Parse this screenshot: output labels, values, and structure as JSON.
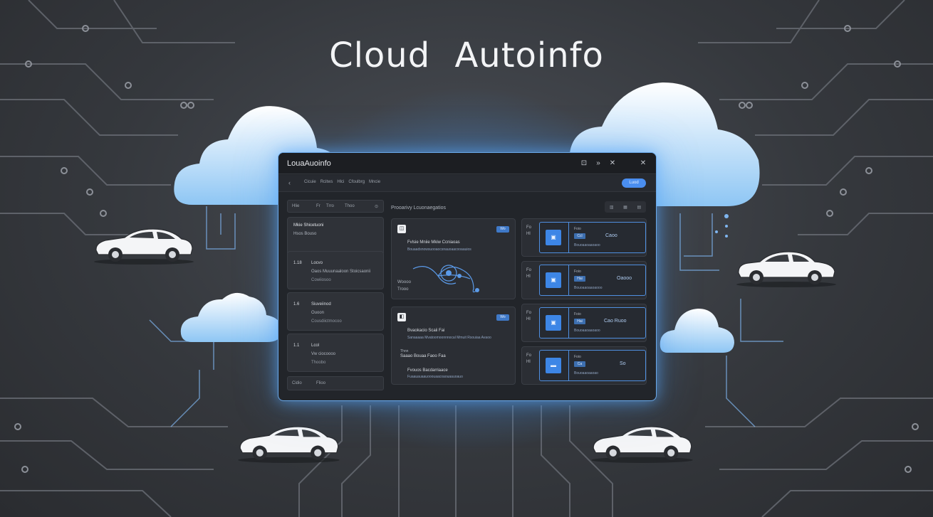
{
  "hero": {
    "title": "Cloud Autoinfo"
  },
  "window": {
    "title": "LouaAuoinfo",
    "controls": {
      "min": "⊡",
      "max": "»",
      "restore": "✕",
      "close": "✕"
    }
  },
  "toolbar": {
    "back": "‹",
    "nav": [
      "Cicuie",
      "Rcitws",
      "Hlci",
      "Cfoulbrg",
      "Mncie"
    ],
    "action": "Luod"
  },
  "sidebar": {
    "filter": [
      "Hlie",
      "Fr",
      "Trro",
      "Thoo",
      "⊙"
    ],
    "vehicles": [
      {
        "id": "",
        "line1": "Mkie Shicetuoni",
        "line2": "Hsos Bouso",
        "line3": ""
      },
      {
        "id": "1.18",
        "line1": "Locvo",
        "line2": "Oaos Muuunaaloon Stoicsaonii",
        "line3": "Cowiiosoo"
      },
      {
        "id": "1.6",
        "line1": "Siuveiinod",
        "line2": "Ouoon",
        "line3": "Cousdiictmocoo"
      },
      {
        "id": "1.1",
        "line1": "Lcol",
        "line2": "Vw ciocoooo",
        "line3": "Thoobo"
      }
    ],
    "footer": [
      "Cidio",
      "Flioo"
    ]
  },
  "main": {
    "section_title": "Prooarivy Lcuonaegatios",
    "view_buttons": [
      "▥",
      "▦",
      "▤"
    ],
    "cards": [
      {
        "icon": "◫",
        "tag": "Wo",
        "heading": "Fvlsie Mniie Mkiw Ccniaoas",
        "subheading": "Bouaadsnowsuooaocsnauoaacooaauios",
        "meta1": "Woooo",
        "meta2": "Trooo"
      },
      {
        "icon": "◧",
        "tag": "Wo",
        "line1": "Bvaokacio Scaii Fai",
        "line2": "Sanaaaaa Mvatoomoonnnocal Mmuit Rsouiaa Avaoo",
        "line3": "Thnn",
        "line4": "Saaao Bouaa Faoo Faa",
        "line5": "Fvouos Bacdarriaace",
        "line6": "Fuaauauaauooouaacoaouaauoauo"
      }
    ],
    "stats": [
      {
        "side1": "Fo",
        "side2": "Hl",
        "label": "Foio",
        "chip": "Ccl",
        "value": "Caoo",
        "sub": "Bouoaaoaaoaoo"
      },
      {
        "side1": "Fo",
        "side2": "Hl",
        "label": "Foio",
        "chip": "Hai",
        "value": "Oaooo",
        "sub": "Bouoaaoaaoaooo"
      },
      {
        "side1": "Fo",
        "side2": "Hl",
        "label": "Foio",
        "chip": "Hai",
        "value": "Cao Ruoo",
        "sub": "Bouoaaoaaoaoo"
      },
      {
        "side1": "Fo",
        "side2": "Hl",
        "label": "Foio",
        "chip": "Ca",
        "value": "So",
        "sub": "Bouoaaoaaoao"
      }
    ]
  },
  "colors": {
    "accent": "#4a8ef0",
    "glow": "#5aaaff",
    "background": "#35383d",
    "window_bg": "#22252a"
  }
}
